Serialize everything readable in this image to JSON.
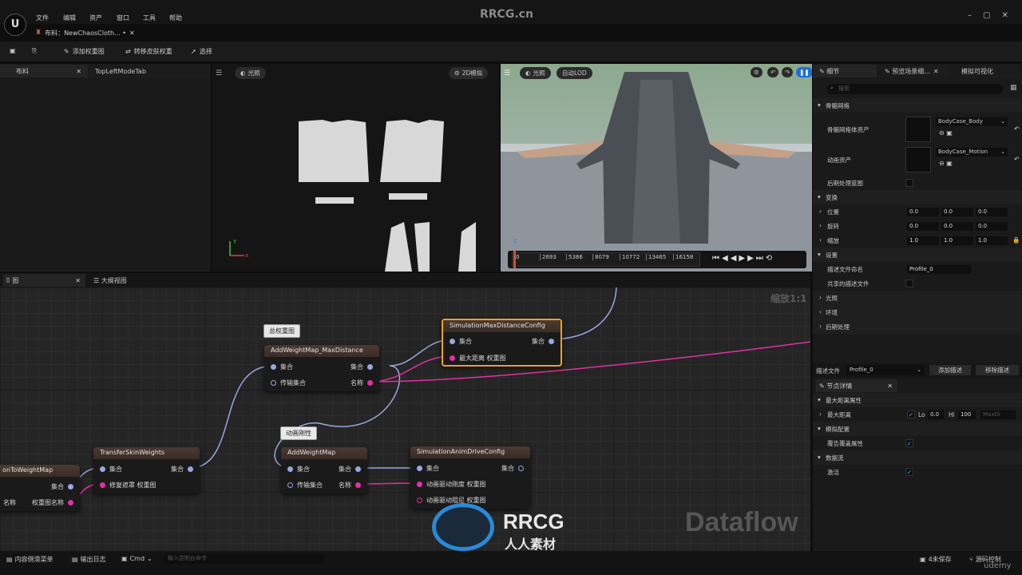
{
  "watermark": {
    "top": "RRCG.cn",
    "brand": "RRCG",
    "brand_cn": "人人素材",
    "udemy": "udemy"
  },
  "menu": [
    "文件",
    "编辑",
    "资产",
    "窗口",
    "工具",
    "帮助"
  ],
  "document_tab": "布料：NewChaosCloth... •",
  "toolbar": {
    "add_weight_map": "添加权重图",
    "transfer_skin_weights": "转移皮肤权重",
    "select": "选择"
  },
  "left_tabs": {
    "cloth": "布料",
    "top_left_mode": "TopLeftModeTab"
  },
  "viewport2d": {
    "lit": "光照",
    "mode": "2D模拟"
  },
  "viewport3d": {
    "lit": "光照",
    "lod": "自动LOD"
  },
  "timeline": {
    "ticks": [
      "0",
      "2693",
      "5386",
      "8079",
      "10772",
      "13465",
      "16158"
    ]
  },
  "graph_tabs": {
    "graph": "图",
    "outline": "大纲视图"
  },
  "zoom_label": "缩放1:1",
  "dataflow_label": "Dataflow",
  "comments": {
    "total_weight": "总权重图",
    "anim_stiffness": "动画刚性"
  },
  "nodes": {
    "max_dist_config": {
      "title": "SimulationMaxDistanceConfig",
      "in1": "集合",
      "out1": "集合",
      "in2": "最大距离 权重图"
    },
    "add_weight_max": {
      "title": "AddWeightMap_MaxDistance",
      "in1": "集合",
      "out1": "集合",
      "in2": "传输集合",
      "out2": "名称"
    },
    "transfer_skin": {
      "title": "TransferSkinWeights",
      "in1": "集合",
      "out1": "集合",
      "in2": "修复遮罩 权重图"
    },
    "to_weight": {
      "title": "onToWeightMap",
      "out1": "集合",
      "left2": "名称",
      "out2": "权重图名称"
    },
    "add_weight": {
      "title": "AddWeightMap",
      "in1": "集合",
      "out1": "集合",
      "in2": "传输集合",
      "out2": "名称"
    },
    "anim_drive": {
      "title": "SimulationAnimDriveConfig",
      "in1": "集合",
      "out1": "集合",
      "in2": "动画驱动刚度 权重图",
      "in3": "动画驱动阻尼 权重图"
    }
  },
  "details": {
    "tabs": [
      "细节",
      "预览场景细...",
      "模拟可视化"
    ],
    "search_placeholder": "搜索",
    "skeletal_mesh_section": "骨骼网格",
    "skeletal_asset_label": "骨骼网格体资产",
    "skeletal_asset_value": "BodyCase_Body",
    "anim_asset_label": "动画资产",
    "anim_asset_value": "BodyCase_Motion",
    "post_process_label": "后期处理蓝图",
    "transform_section": "变换",
    "location": {
      "label": "位置",
      "values": [
        "0.0",
        "0.0",
        "0.0"
      ]
    },
    "rotation": {
      "label": "旋转",
      "values": [
        "0.0",
        "0.0",
        "0.0"
      ]
    },
    "scale": {
      "label": "缩放",
      "values": [
        "1.0",
        "1.0",
        "1.0"
      ]
    },
    "settings_section": "设置",
    "profile_name_label": "描述文件命名",
    "profile_name_value": "Profile_0",
    "shared_profile_label": "共享的描述文件",
    "lighting": "光照",
    "environment": "环境",
    "post_processing": "后期处理",
    "profile_label": "描述文件",
    "profile_value": "Profile_0",
    "add_profile": "添加描述",
    "remove_profile": "移除描述",
    "node_details_tab": "节点详情",
    "max_distance_section": "最大距离属性",
    "max_distance_label": "最大距离",
    "lo_label": "Lo",
    "lo_value": "0.0",
    "hi_label": "Hi",
    "hi_value": "100",
    "max_dist_placeholder": "MaxDi",
    "sim_config_section": "模拟配置",
    "override_label": "覆告覆盖属性",
    "data_flow_section": "数据流",
    "activate_label": "激活"
  },
  "statusbar": {
    "content_drawer": "内容侧滑菜单",
    "output_log": "输出日志",
    "cmd": "Cmd",
    "cmd_placeholder": "输入控制台命令",
    "unsaved": "4未保存",
    "source_control": "源码控制"
  }
}
